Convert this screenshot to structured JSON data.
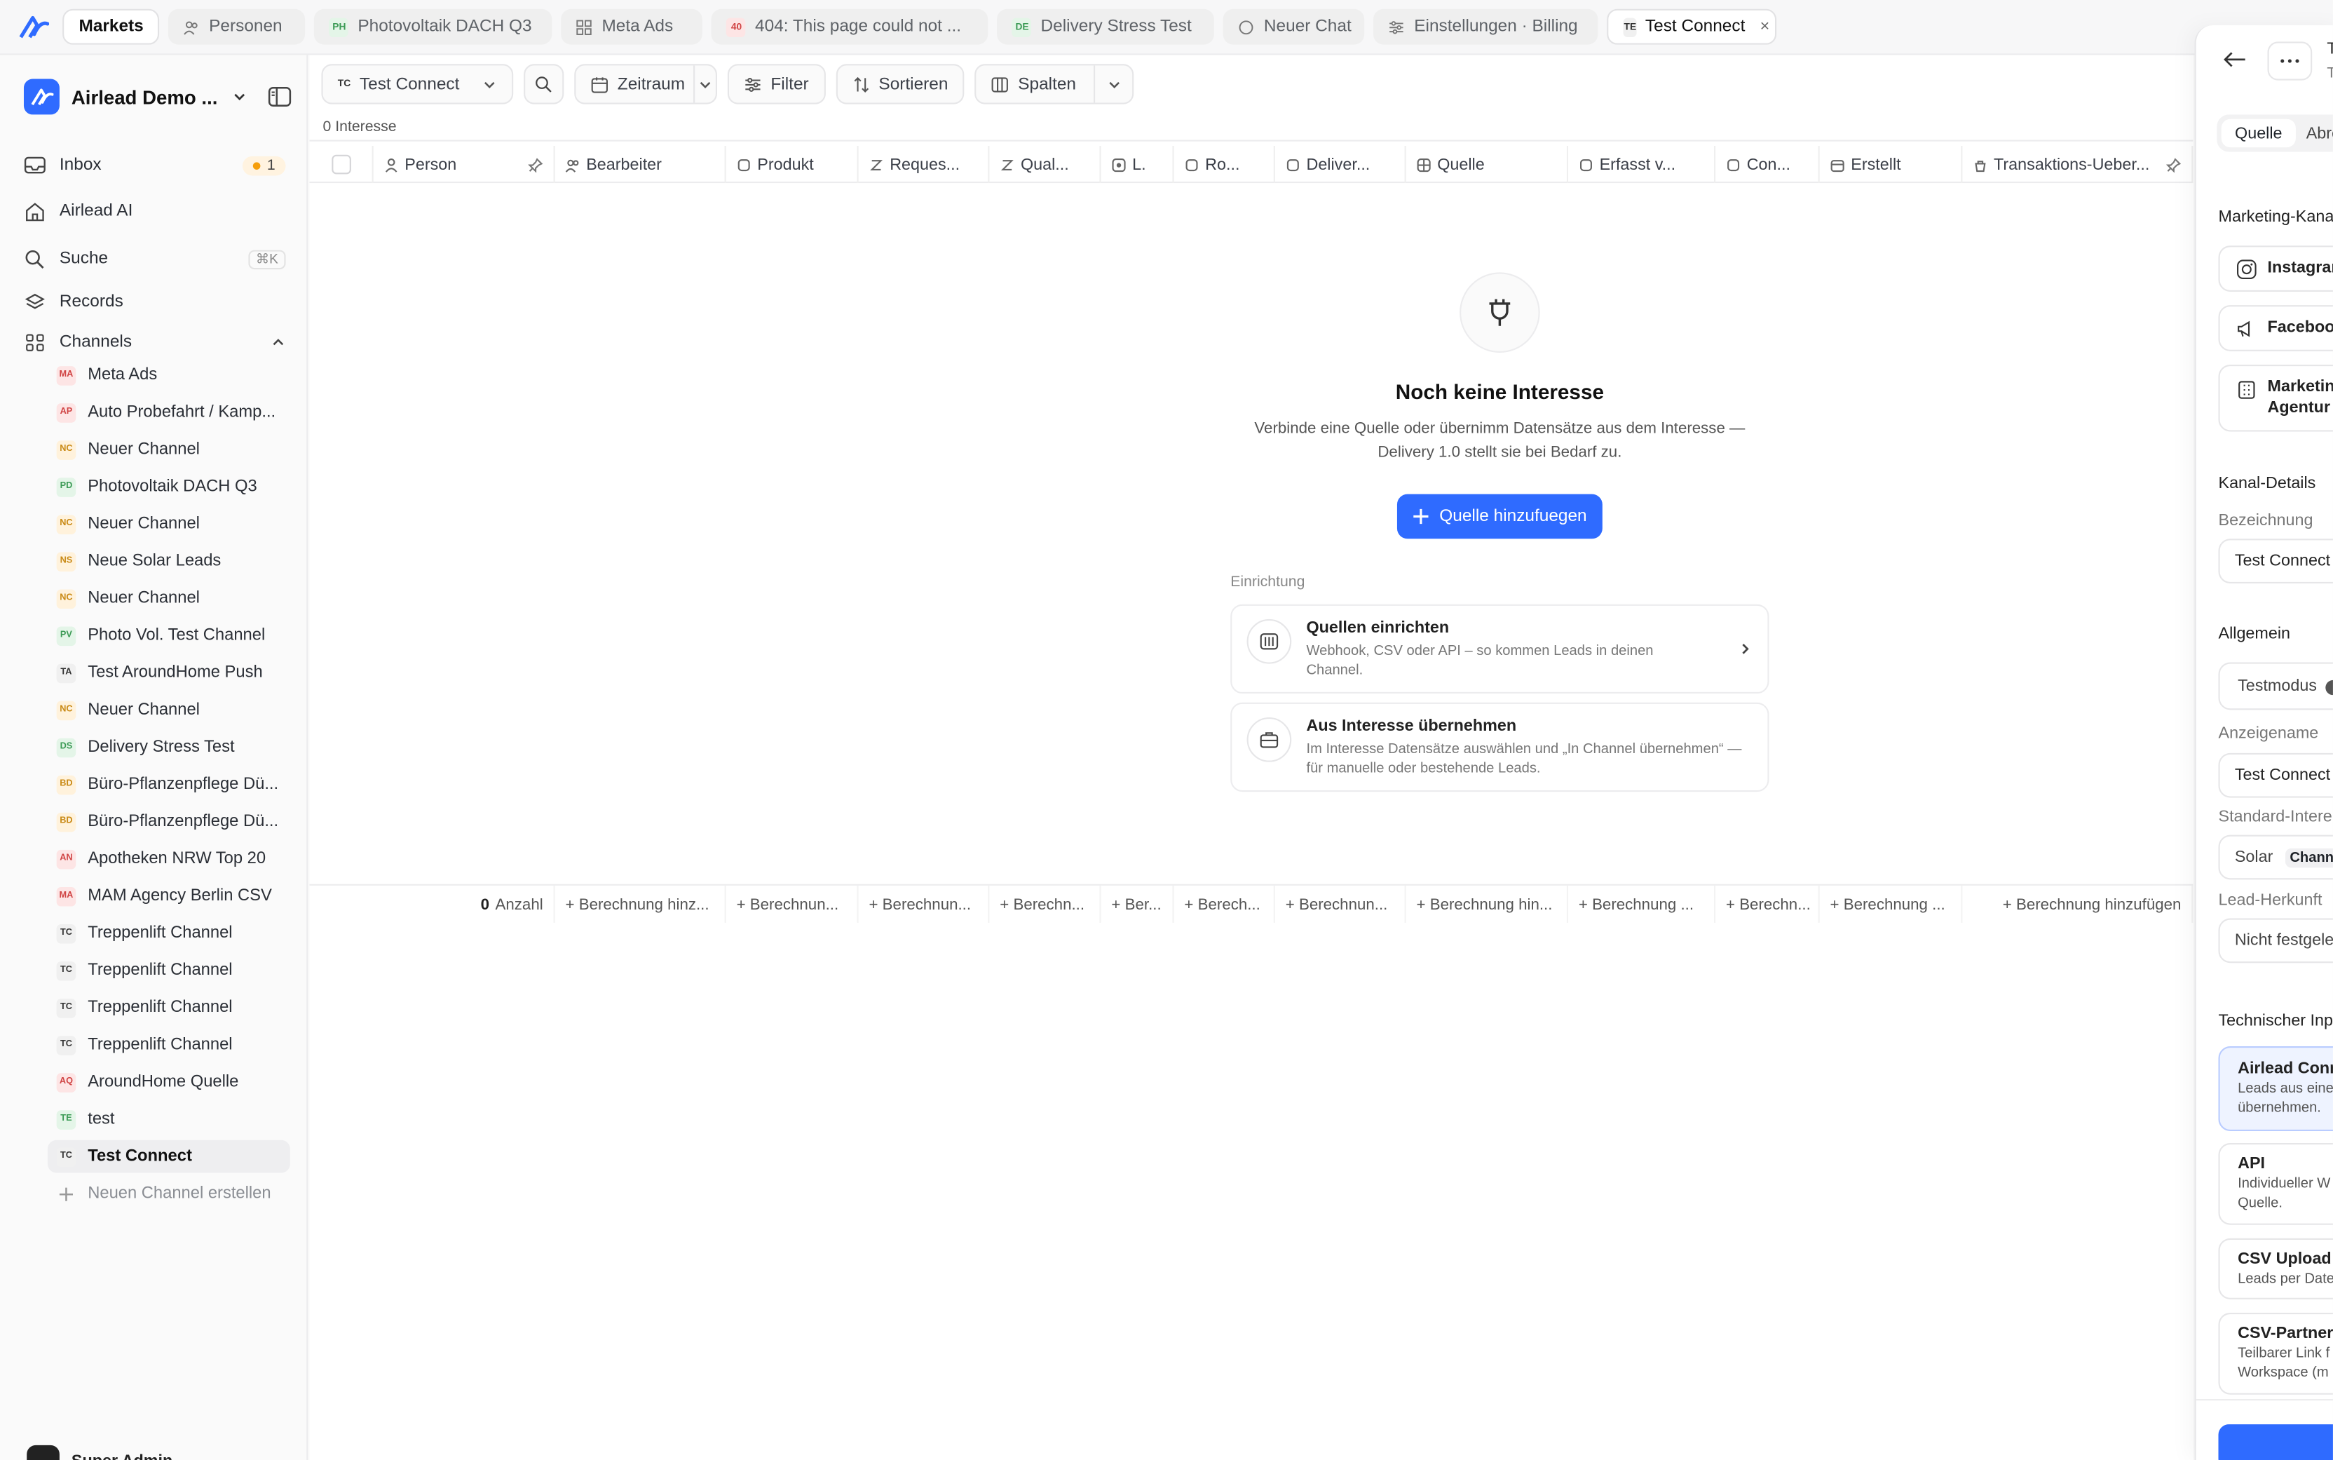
{
  "colors": {
    "accent": "#2f6bff",
    "badge_orange": "#f59e0b"
  },
  "tabs": {
    "markets": "Markets",
    "personen": "Personen",
    "photovoltaik_badge": "PH",
    "photovoltaik": "Photovoltaik DACH Q3",
    "meta_ads": "Meta Ads",
    "error_badge": "40",
    "error": "404: This page could not ...",
    "delivery_badge": "DE",
    "delivery": "Delivery Stress Test",
    "neuer_chat": "Neuer Chat",
    "einstellungen": "Einstellungen · Billing",
    "active_badge": "TE",
    "active": "Test Connect",
    "close": "×"
  },
  "sidebar": {
    "workspace": "Airlead Demo ...",
    "inbox": "Inbox",
    "inbox_count": "1",
    "airlead_ai": "Airlead AI",
    "suche": "Suche",
    "suche_kbd": "⌘K",
    "records": "Records",
    "channels": "Channels",
    "channel_list": [
      {
        "abbr": "MA",
        "name": "Meta Ads"
      },
      {
        "abbr": "AP",
        "name": "Auto Probefahrt / Kamp..."
      },
      {
        "abbr": "NC",
        "name": "Neuer Channel"
      },
      {
        "abbr": "PD",
        "name": "Photovoltaik DACH Q3"
      },
      {
        "abbr": "NC",
        "name": "Neuer Channel"
      },
      {
        "abbr": "NS",
        "name": "Neue Solar Leads"
      },
      {
        "abbr": "NC",
        "name": "Neuer Channel"
      },
      {
        "abbr": "PV",
        "name": "Photo Vol. Test Channel"
      },
      {
        "abbr": "TA",
        "name": "Test AroundHome Push"
      },
      {
        "abbr": "NC",
        "name": "Neuer Channel"
      },
      {
        "abbr": "DS",
        "name": "Delivery Stress Test"
      },
      {
        "abbr": "BD",
        "name": "Büro-Pflanzenpflege Dü..."
      },
      {
        "abbr": "BD",
        "name": "Büro-Pflanzenpflege Dü..."
      },
      {
        "abbr": "AN",
        "name": "Apotheken NRW Top 20"
      },
      {
        "abbr": "MA",
        "name": "MAM Agency Berlin CSV"
      },
      {
        "abbr": "TC",
        "name": "Treppenlift Channel"
      },
      {
        "abbr": "TC",
        "name": "Treppenlift Channel"
      },
      {
        "abbr": "TC",
        "name": "Treppenlift Channel"
      },
      {
        "abbr": "TC",
        "name": "Treppenlift Channel"
      },
      {
        "abbr": "AQ",
        "name": "AroundHome Quelle"
      },
      {
        "abbr": "TE",
        "name": "test"
      },
      {
        "abbr": "TC",
        "name": "Test Connect"
      }
    ],
    "new_channel": "Neuen Channel erstellen",
    "user": "Super Admin"
  },
  "toolbar": {
    "channel_badge": "TC",
    "channel": "Test Connect",
    "zeitraum": "Zeitraum",
    "filter": "Filter",
    "sortieren": "Sortieren",
    "spalten": "Spalten"
  },
  "table": {
    "count": "0 Interesse",
    "columns": [
      "Person",
      "Bearbeiter",
      "Produkt",
      "Reques...",
      "Qual...",
      "L.",
      "Ro...",
      "Deliver...",
      "Quelle",
      "Erfasst v...",
      "Con...",
      "Erstellt",
      "Transaktions-Ueber..."
    ],
    "footer_count": "0",
    "footer_count_label": "Anzahl",
    "footer_cells": [
      "+ Berechnung hinz...",
      "+ Berechnun...",
      "+ Berechnun...",
      "+ Berechn...",
      "+ Ber...",
      "+ Berech...",
      "+ Berechnun...",
      "+ Berechnung hin...",
      "+ Berechnung ...",
      "+ Berechn...",
      "+ Berechnung ...",
      "+ Berechnung hinzufügen"
    ]
  },
  "empty": {
    "title": "Noch keine Interesse",
    "desc_line1": "Verbinde eine Quelle oder übernimm Datensätze aus dem Interesse —",
    "desc_line2": "Delivery 1.0 stellt sie bei Bedarf zu.",
    "cta": "Quelle hinzufuegen",
    "setup_label": "Einrichtung",
    "card1_title": "Quellen einrichten",
    "card1_desc": "Webhook, CSV oder API – so kommen Leads in deinen Channel.",
    "card2_title": "Aus Interesse übernehmen",
    "card2_desc": "Im Interesse Datensätze auswählen und „In Channel übernehmen“ — für manuelle oder bestehende Leads."
  },
  "rpanel": {
    "title_char": "T",
    "subtitle_char": "T",
    "tab_quelle": "Quelle",
    "tab_other": "Abre",
    "marketing_kanal": "Marketing-Kana",
    "instagram": "Instagrar",
    "facebook": "Faceboo",
    "marketing": "Marketing",
    "agentur": "Agentur",
    "kanal_details": "Kanal-Details",
    "bezeichnung": "Bezeichnung",
    "bezeichnung_value": "Test Connect",
    "allgemein": "Allgemein",
    "testmodus": "Testmodus",
    "anzeigename": "Anzeigename",
    "anzeigename_value": "Test Connect",
    "standard": "Standard-Intere",
    "solar": "Solar",
    "channel_chip": "Channe",
    "lead_herkunft": "Lead-Herkunft",
    "nicht": "Nicht festgele",
    "technischer": "Technischer Inp",
    "airlead_conn": "Airlead Conn",
    "airlead_desc1": "Leads aus eine",
    "airlead_desc2": "übernehmen.",
    "api": "API",
    "api_desc1": "Individueller W",
    "api_desc2": "Quelle.",
    "csv": "CSV Upload",
    "csv_desc": "Leads per Date",
    "csv_partner": "CSV-Partnerl",
    "csv_partner_desc1": "Teilbarer Link f",
    "csv_partner_desc2": "Workspace (m"
  }
}
